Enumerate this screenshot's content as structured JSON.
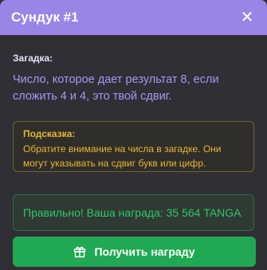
{
  "header": {
    "title": "Сундук #1",
    "close_icon": "close-icon"
  },
  "riddle": {
    "label": "Загадка:",
    "text": "Число, которое дает результат 8, если сложить 4 и 4, это твой сдвиг."
  },
  "hint": {
    "label": "Подсказка:",
    "text": "Обратите внимание на числа в загадке. Они могут указывать на сдвиг букв или цифр.",
    "color": "#e6b82e"
  },
  "result": {
    "text": "Правильно! Ваша награда: 35 564 TANGA",
    "color": "#2ec76b"
  },
  "claim_button": {
    "label": "Получить награду",
    "icon": "gift-icon",
    "color": "#20a852"
  },
  "colors": {
    "header_bg": "#9a85e6",
    "background": "#2f2f35",
    "riddle_text": "#a996f0"
  }
}
